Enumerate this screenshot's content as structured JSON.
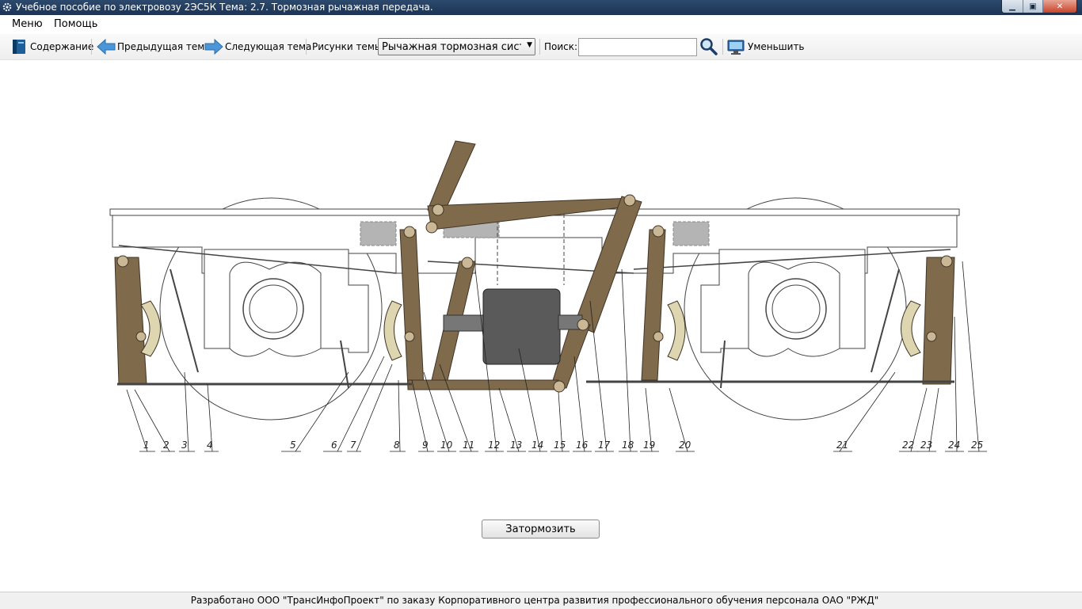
{
  "window": {
    "title": "Учебное пособие по электровозу 2ЭС5К Тема: 2.7. Тормозная рычажная передача.",
    "icon": "gear-icon"
  },
  "menu": {
    "items": [
      "Меню",
      "Помощь"
    ]
  },
  "toolbar": {
    "contents_label": "Содержание",
    "prev_label": "Предыдущая тема",
    "next_label": "Следующая тема",
    "figures_label": "Рисунки темы",
    "figures_selected": "Рычажная тормозная система",
    "search_label": "Поиск:",
    "search_value": "",
    "shrink_label": "Уменьшить"
  },
  "diagram": {
    "callouts": [
      "1",
      "2",
      "3",
      "4",
      "5",
      "6",
      "7",
      "8",
      "9",
      "10",
      "11",
      "12",
      "13",
      "14",
      "15",
      "16",
      "17",
      "18",
      "19",
      "20",
      "21",
      "22",
      "23",
      "24",
      "25"
    ]
  },
  "actions": {
    "brake_button": "Затормозить"
  },
  "status": {
    "text": "Разработано ООО \"ТрансИнфоПроект\" по заказу Корпоративного центра развития профессионального обучения персонала ОАО \"РЖД\""
  },
  "colors": {
    "lever": "#7f6a4b",
    "cylinder": "#5a5a5a",
    "gray_block": "#b4b4b4",
    "shoe": "#ddd6b0"
  }
}
